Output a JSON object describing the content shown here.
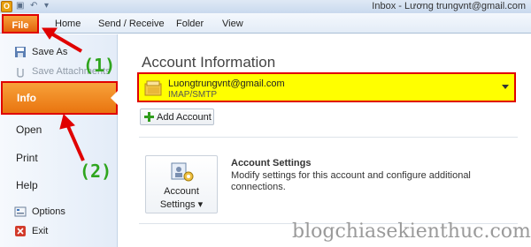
{
  "window": {
    "title": "Inbox - Lương trungvnt@gmail.com"
  },
  "ribbon": {
    "file_label": "File",
    "tabs": [
      "Home",
      "Send / Receive",
      "Folder",
      "View"
    ]
  },
  "backstage": {
    "nav": {
      "save_as": "Save As",
      "save_attachments": "Save Attachments",
      "info": "Info",
      "open": "Open",
      "print": "Print",
      "help": "Help",
      "options": "Options",
      "exit": "Exit"
    }
  },
  "main": {
    "title": "Account Information",
    "account": {
      "email": "Luongtrungvnt@gmail.com",
      "type": "IMAP/SMTP"
    },
    "add_account_label": "Add Account",
    "account_settings": {
      "button_line1": "Account",
      "button_line2": "Settings ▾",
      "heading": "Account Settings",
      "description": "Modify settings for this account and configure additional connections."
    }
  },
  "annotations": {
    "step1": "(1)",
    "step2": "(2)",
    "watermark": "blogchiasekienthuc.com"
  },
  "colors": {
    "highlight": "#ffff00",
    "callout": "#e00000",
    "file_orange": "#e9740f",
    "step_green": "#2fa51e"
  },
  "icons": [
    "outlook-app-icon",
    "save-icon",
    "undo-icon",
    "folder-mail-icon",
    "plus-icon",
    "account-settings-icon",
    "options-icon",
    "exit-icon"
  ]
}
